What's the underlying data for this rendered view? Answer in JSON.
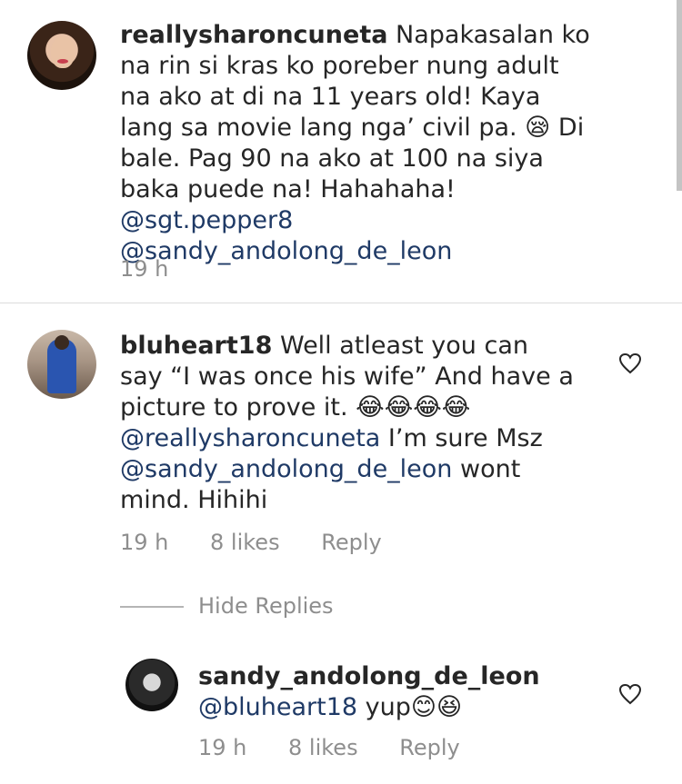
{
  "comments": [
    {
      "username": "reallysharoncuneta",
      "text_parts": [
        "Napakasalan ko na rin si kras ko poreber nung adult na ako at di na 11 years old! Kaya lang sa movie lang nga’ civil pa. 😪 Di bale. Pag 90 na ako at 100 na siya baka puede na! Hahahaha! "
      ],
      "mentions": [
        "@sgt.pepper8",
        "@sandy_andolong_de_leon"
      ],
      "time": "19 h"
    },
    {
      "username": "bluheart18",
      "text_a": "Well atleast you can say “I was once his wife” And have a picture to prove it. 😂😂😂😂",
      "mention1": "@reallysharoncuneta",
      "text_b": " I’m sure Msz ",
      "mention2": "@sandy_andolong_de_leon",
      "text_c": " wont mind. Hihihi",
      "time": "19 h",
      "likes": "8 likes",
      "reply": "Reply"
    },
    {
      "username": "sandy_andolong_de_leon",
      "mention": "@bluheart18",
      "text": " yup😊😆",
      "time": "19 h",
      "likes": "8 likes",
      "reply": "Reply"
    }
  ],
  "hide_replies": "Hide Replies",
  "icons": {
    "like": "heart-outline-icon"
  }
}
